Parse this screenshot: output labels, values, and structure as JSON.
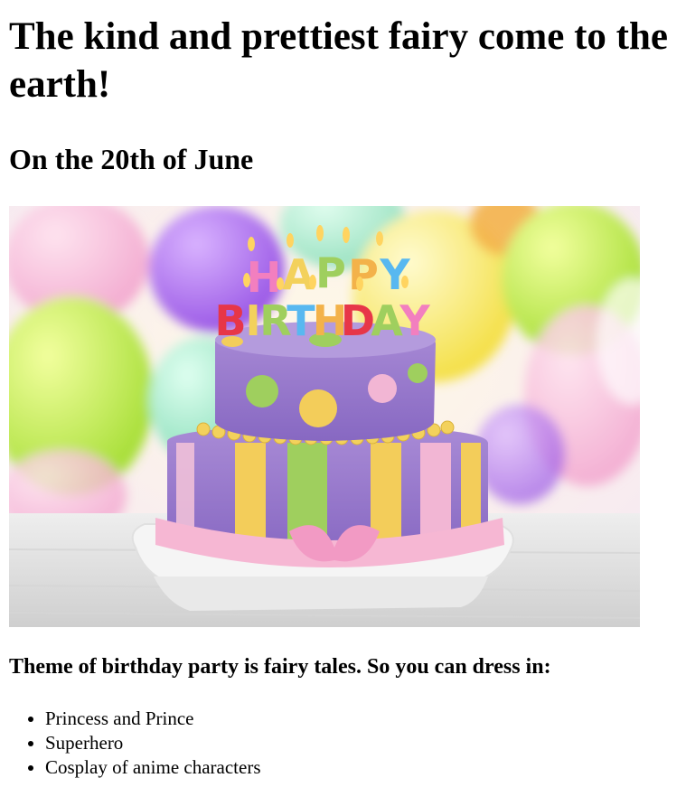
{
  "heading": "The kind and prettiest fairy come to the earth!",
  "date": "On the 20th of June",
  "image": {
    "description": "birthday-cake-photo",
    "candles_top": "HAPPY",
    "candles_bottom": "BIRTHDAY"
  },
  "theme_text": "Theme of birthday party is fairy tales. So you can dress in:",
  "costumes": [
    "Princess and Prince",
    "Superhero",
    "Cosplay of anime characters"
  ]
}
